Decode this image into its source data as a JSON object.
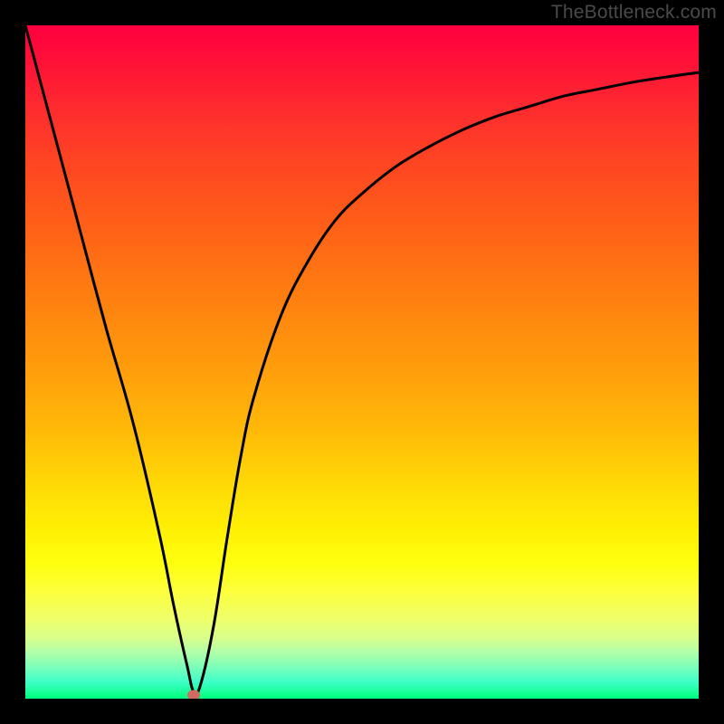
{
  "attribution": "TheBottleneck.com",
  "colors": {
    "top": "#ff0040",
    "bottom": "#00ff7c",
    "curve": "#000000",
    "marker": "#cf6b62"
  },
  "chart_data": {
    "type": "line",
    "title": "",
    "xlabel": "",
    "ylabel": "",
    "xlim": [
      0,
      100
    ],
    "ylim": [
      0,
      100
    ],
    "grid": false,
    "series": [
      {
        "name": "bottleneck-curve",
        "x": [
          0,
          4,
          8,
          12,
          16,
          20,
          22,
          24,
          25,
          26,
          28,
          30,
          32,
          34,
          38,
          42,
          46,
          50,
          55,
          60,
          65,
          70,
          75,
          80,
          85,
          90,
          95,
          100
        ],
        "values": [
          100,
          85,
          70,
          55,
          41,
          24,
          14,
          5,
          1,
          2,
          11,
          24,
          36,
          45,
          57,
          65,
          71,
          75,
          79,
          82,
          84.5,
          86.5,
          88,
          89.5,
          90.5,
          91.5,
          92.3,
          93
        ]
      }
    ],
    "marker": {
      "x": 25,
      "y": 0.5
    },
    "annotations": []
  }
}
